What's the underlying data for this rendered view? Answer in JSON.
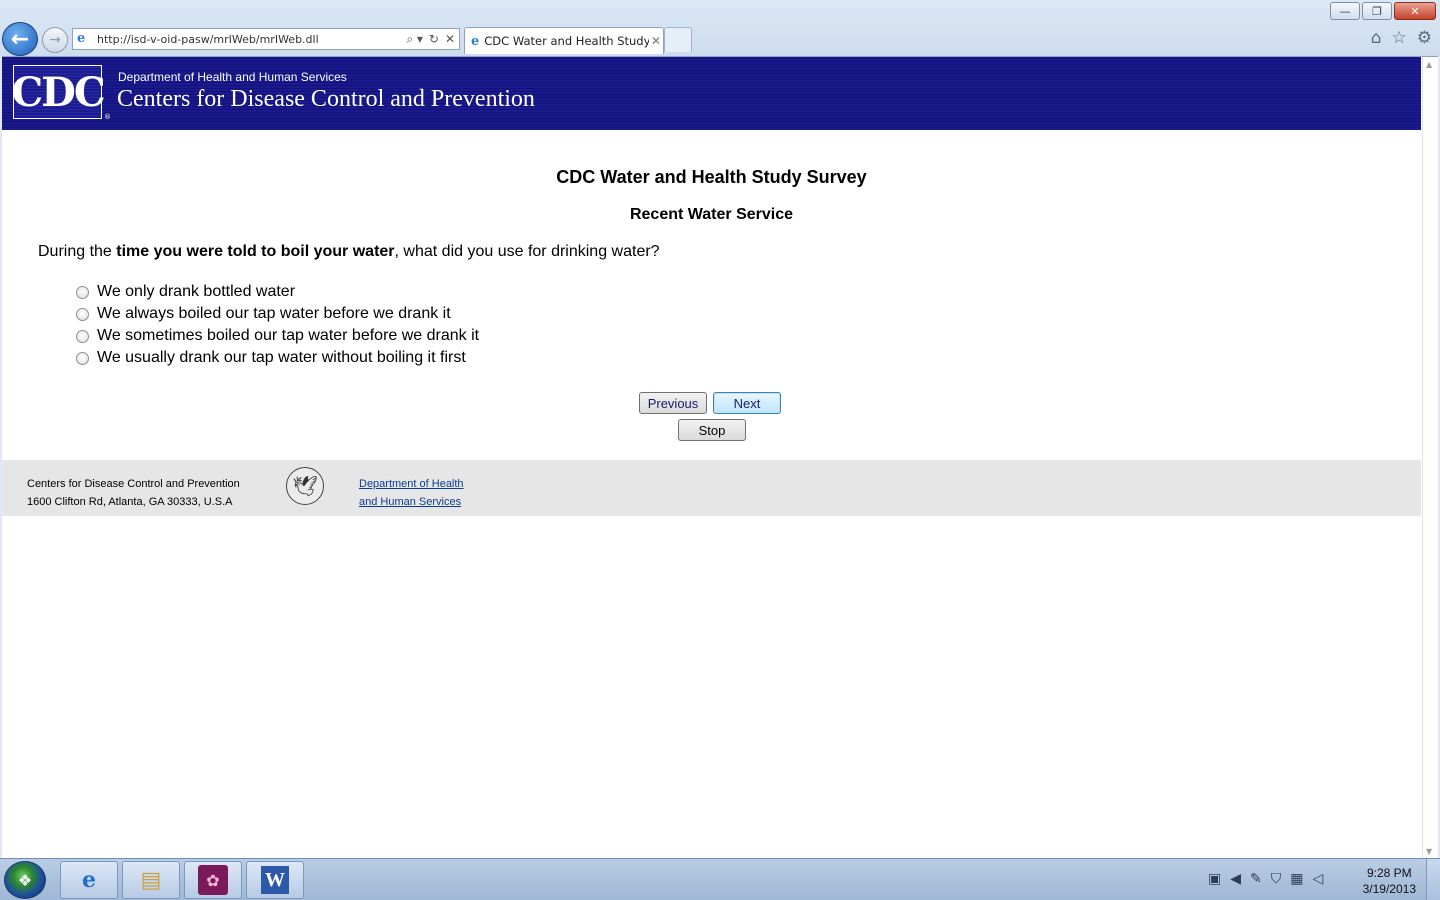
{
  "browser": {
    "url": "http://isd-v-oid-pasw/mrIWeb/mrIWeb.dll",
    "tab_title": "CDC Water and Health Study",
    "controls": {
      "minimize": "—",
      "restore": "❐",
      "close": "✕"
    },
    "addr_tools": [
      "⌕ ▾",
      "↻",
      "✕"
    ],
    "right_icons": [
      "home-icon",
      "favorites-star-icon",
      "gear-icon"
    ]
  },
  "header": {
    "logo_text": "CDC",
    "trademark": "®",
    "department": "Department of Health and Human Services",
    "agency": "Centers for Disease Control and Prevention"
  },
  "survey": {
    "title": "CDC Water and Health Study Survey",
    "section": "Recent Water Service",
    "question_prefix": "During the ",
    "question_bold": "time you were told to boil your water",
    "question_suffix": ", what did you use for drinking water?",
    "options": [
      "We only drank bottled water",
      "We always boiled our tap water before we drank it",
      "We sometimes boiled our tap water before we drank it",
      "We usually drank our tap water without boiling it first"
    ],
    "buttons": {
      "previous": "Previous",
      "next": "Next",
      "stop": "Stop"
    }
  },
  "footer": {
    "org_name": "Centers for Disease Control and Prevention",
    "address": "1600 Clifton Rd, Atlanta, GA 30333, U.S.A",
    "link_line1": "Department of Health",
    "link_line2": "and Human Services"
  },
  "taskbar": {
    "apps": [
      "internet-explorer",
      "windows-explorer",
      "media-app",
      "microsoft-word"
    ],
    "time": "9:28 PM",
    "date": "3/19/2013"
  }
}
